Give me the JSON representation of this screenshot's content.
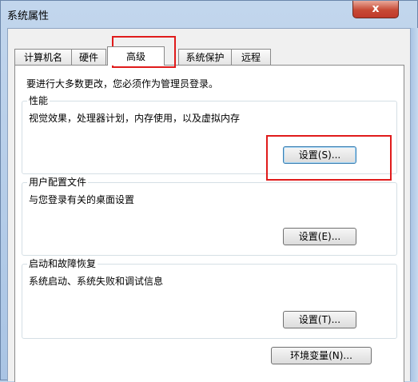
{
  "window": {
    "title": "系统属性",
    "close_label": "x"
  },
  "tabs": [
    {
      "label": "计算机名"
    },
    {
      "label": "硬件"
    },
    {
      "label": "高级"
    },
    {
      "label": "系统保护"
    },
    {
      "label": "远程"
    }
  ],
  "notice": "要进行大多数更改，您必须作为管理员登录。",
  "performance": {
    "title": "性能",
    "description": "视觉效果，处理器计划，内存使用，以及虚拟内存",
    "button": "设置(S)..."
  },
  "user_profiles": {
    "title": "用户配置文件",
    "description": "与您登录有关的桌面设置",
    "button": "设置(E)..."
  },
  "startup_recovery": {
    "title": "启动和故障恢复",
    "description": "系统启动、系统失败和调试信息",
    "button": "设置(T)..."
  },
  "env_button": "环境变量(N)...",
  "highlight_color": "#e01b1b"
}
